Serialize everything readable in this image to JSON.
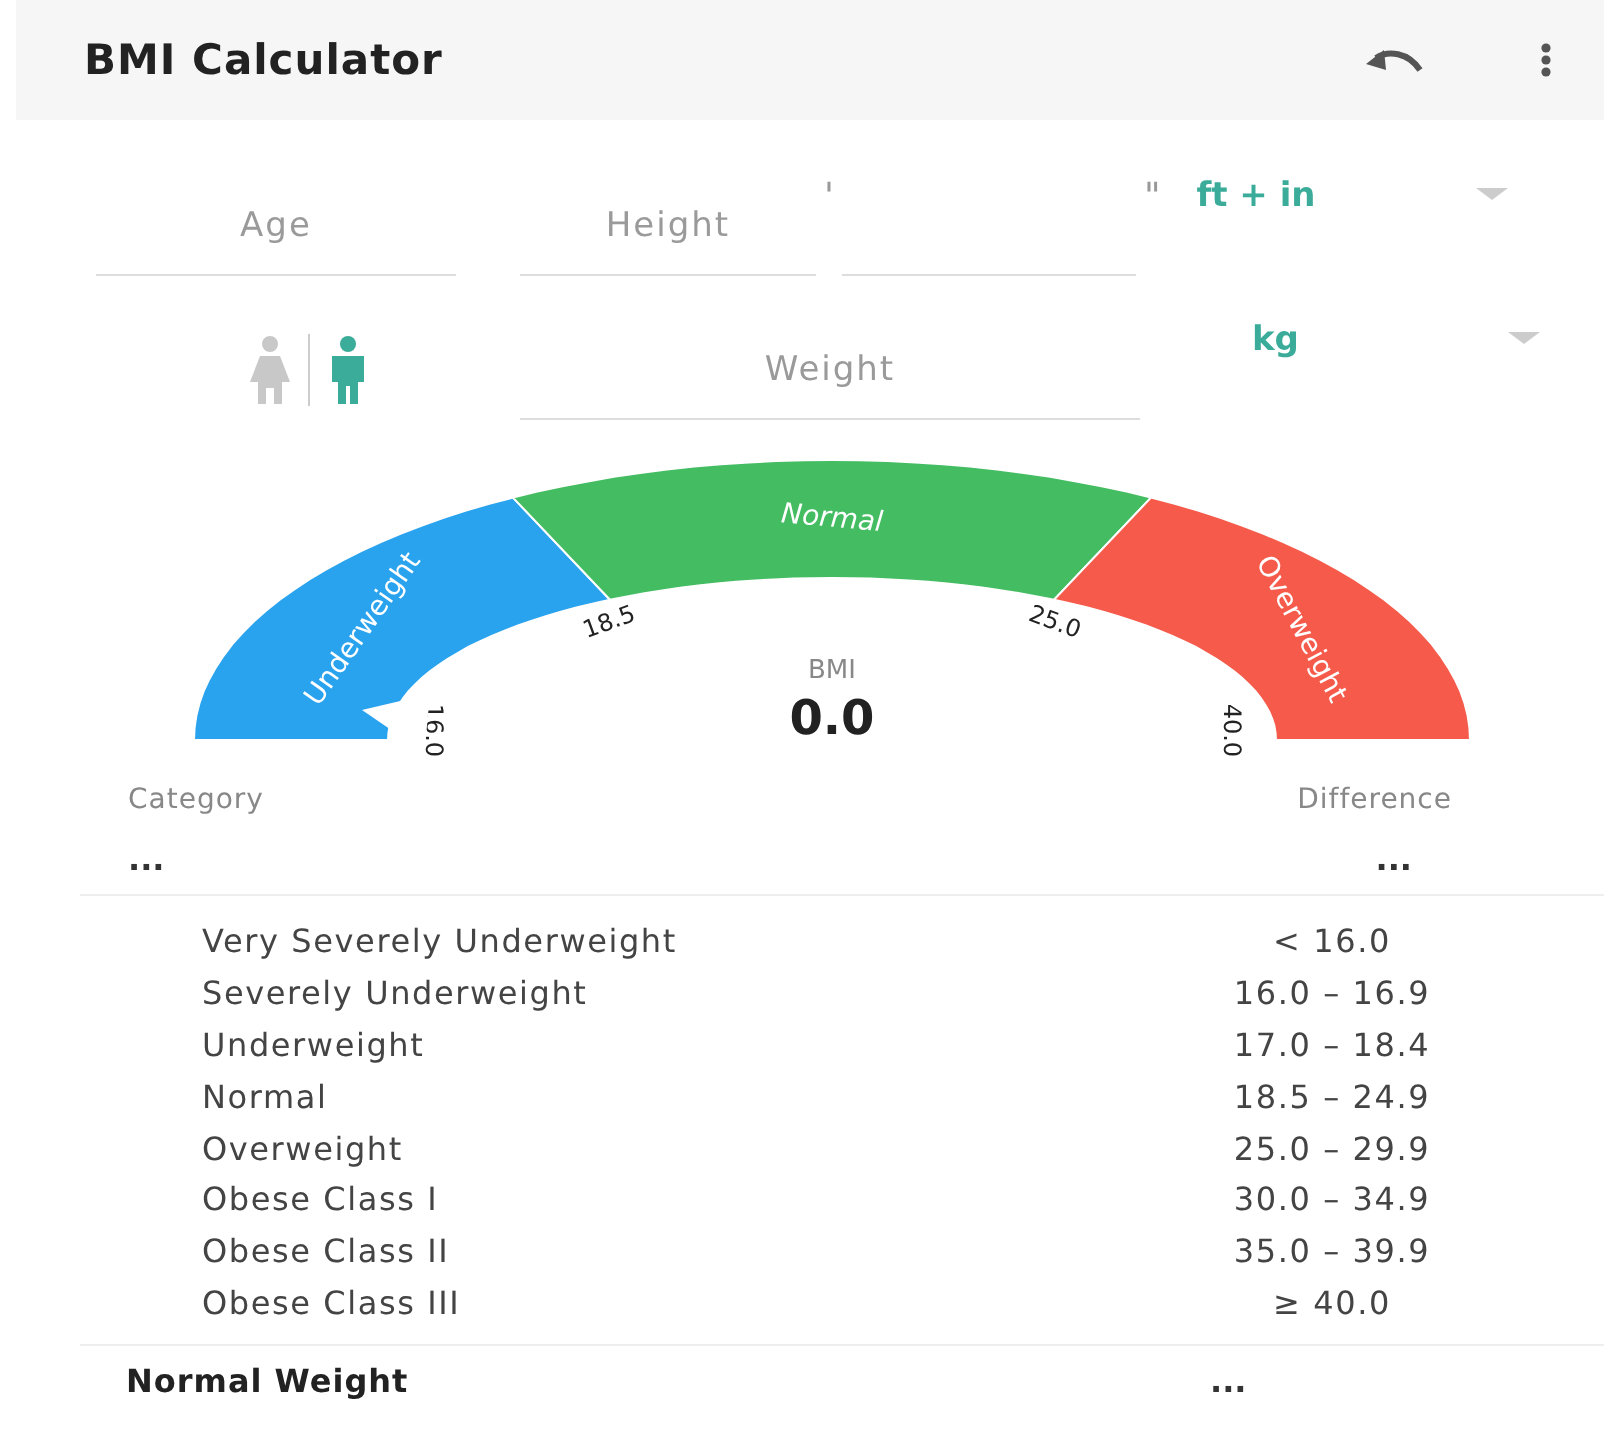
{
  "app_bar": {
    "title": "BMI Calculator"
  },
  "inputs": {
    "age": {
      "placeholder": "Age"
    },
    "height": {
      "placeholder": "Height",
      "feet_mark": "'",
      "inch_mark": "\""
    },
    "height_unit": "ft + in",
    "weight": {
      "placeholder": "Weight"
    },
    "weight_unit": "kg"
  },
  "gender": [
    {
      "kind": "female",
      "selected": false
    },
    {
      "kind": "male",
      "selected": true
    }
  ],
  "gauge": {
    "segments": [
      {
        "label": "Underweight",
        "color": "#2aa3ef"
      },
      {
        "label": "Normal",
        "color": "#43bc62"
      },
      {
        "label": "Overweight",
        "color": "#f55a4a"
      }
    ],
    "ticks": [
      "16.0",
      "18.5",
      "25.0",
      "40.0"
    ],
    "label": "BMI",
    "value": "0.0"
  },
  "result": {
    "category_label": "Category",
    "difference_label": "Difference",
    "category": "...",
    "difference": "..."
  },
  "table": [
    {
      "name": "Very Severely Underweight",
      "range": "< 16.0"
    },
    {
      "name": "Severely Underweight",
      "range": "16.0 – 16.9"
    },
    {
      "name": "Underweight",
      "range": "17.0 – 18.4"
    },
    {
      "name": "Normal",
      "range": "18.5 – 24.9"
    },
    {
      "name": "Overweight",
      "range": "25.0 – 29.9"
    },
    {
      "name": "Obese Class I",
      "range": "30.0 – 34.9"
    },
    {
      "name": "Obese Class II",
      "range": "35.0 – 39.9"
    },
    {
      "name": "Obese Class III",
      "range": "≥ 40.0"
    }
  ],
  "footer": {
    "label": "Normal Weight",
    "value": "..."
  }
}
